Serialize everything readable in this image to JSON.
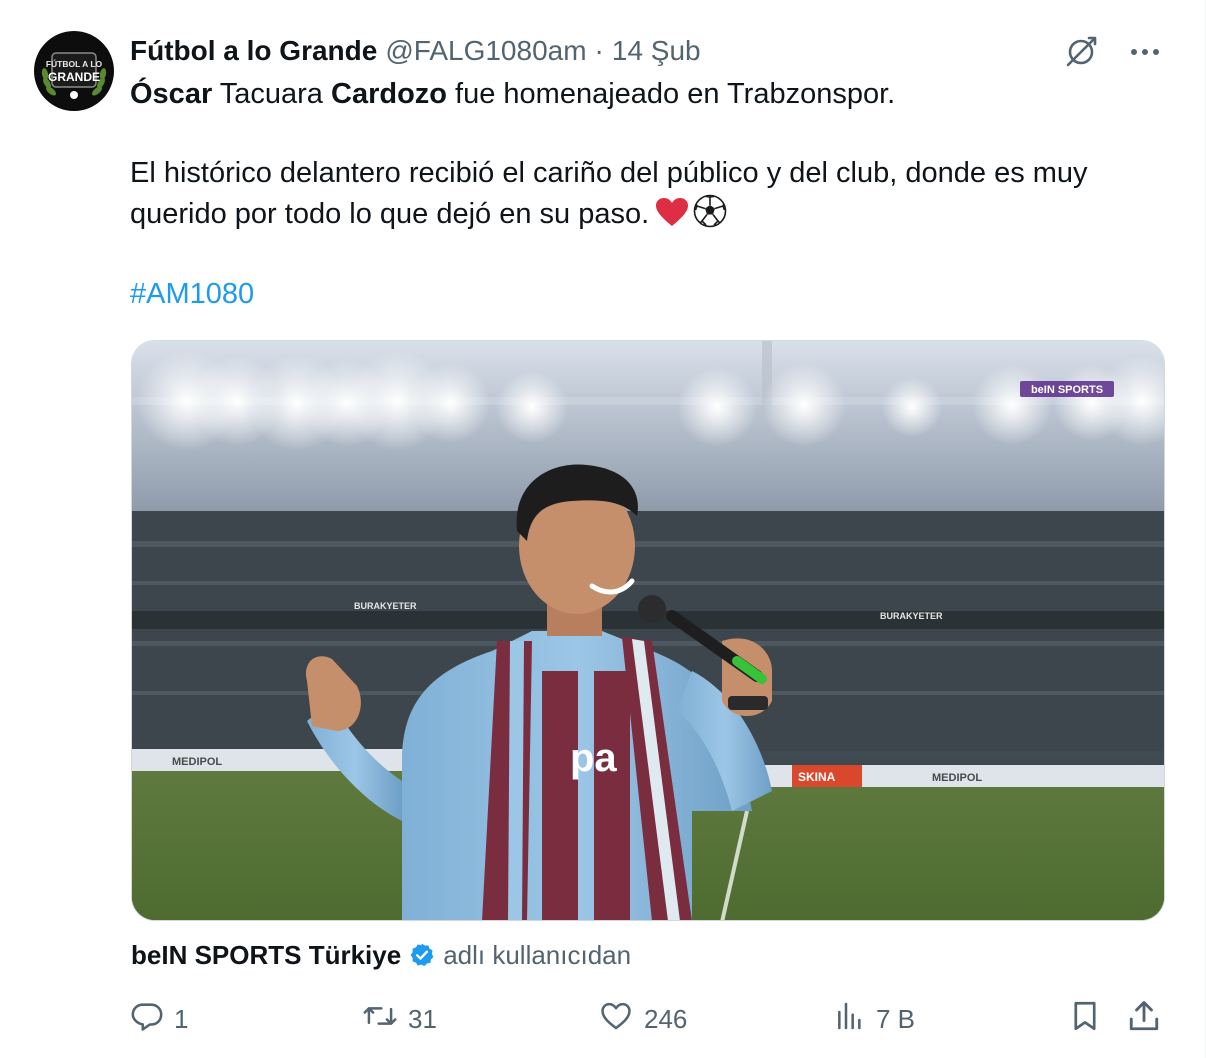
{
  "tweet": {
    "author_name": "Fútbol a lo Grande",
    "author_handle": "@FALG1080am",
    "separator": "·",
    "timestamp": "14 Şub",
    "text": {
      "p1_bold1": "Óscar",
      "p1_mid": " Tacuara ",
      "p1_bold2": "Cardozo",
      "p1_end": " fue homenajeado en Trabzonspor.",
      "p2": "El histórico delantero recibió el cariño del público y del club, donde es muy querido por todo lo que dejó en su paso."
    },
    "hashtag": "#AM1080",
    "avatar_logo_lines": [
      "FÚTBOL A LO",
      "GRANDE"
    ],
    "media": {
      "watermark": "beIN SPORTS",
      "board_texts": [
        "BURAKYETER",
        "MEDIPOL",
        "SKINA",
        "pa"
      ]
    },
    "attribution": {
      "name": "beIN SPORTS Türkiye",
      "suffix": "adlı kullanıcıdan"
    },
    "actions": {
      "replies": "1",
      "retweets": "31",
      "likes": "246",
      "views": "7 B"
    },
    "icons": {
      "grok": "grok-icon",
      "more": "more-icon",
      "reply": "reply-icon",
      "retweet": "retweet-icon",
      "like": "heart-icon",
      "views": "analytics-icon",
      "bookmark": "bookmark-icon",
      "share": "share-icon",
      "verified": "verified-badge-icon"
    },
    "colors": {
      "text": "#0f1419",
      "secondary": "#536471",
      "link": "#1d9bf0",
      "verified": "#1d9bf0"
    }
  }
}
